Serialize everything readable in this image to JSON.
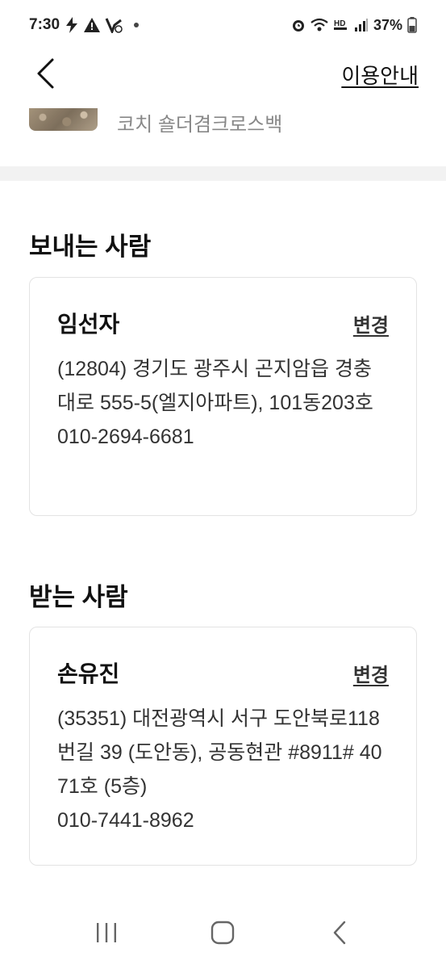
{
  "status_bar": {
    "time": "7:30",
    "battery": "37%",
    "left_icons": [
      "bolt-icon",
      "warning-icon",
      "notification-icon"
    ],
    "right_icons": [
      "alarm-icon",
      "wifi-icon",
      "hd-voice-icon",
      "signal-icon",
      "battery-icon"
    ]
  },
  "header": {
    "guide_label": "이용안내"
  },
  "product": {
    "name": "코치 숄더겸크로스백"
  },
  "sender": {
    "section_title": "보내는 사람",
    "name": "임선자",
    "change_label": "변경",
    "address": "(12804) 경기도 광주시 곤지암읍 경충대로 555-5(엘지아파트), 101동203호",
    "phone": "010-2694-6681"
  },
  "receiver": {
    "section_title": "받는 사람",
    "name": "손유진",
    "change_label": "변경",
    "address": "(35351) 대전광역시 서구 도안북로118번길 39 (도안동), 공동현관 #8911# 4071호 (5층)",
    "phone": "010-7441-8962"
  },
  "colors": {
    "text_primary": "#111111",
    "text_secondary": "#333333",
    "muted": "#888888",
    "divider": "#f2f2f2",
    "card_border": "#e3e3e3"
  }
}
